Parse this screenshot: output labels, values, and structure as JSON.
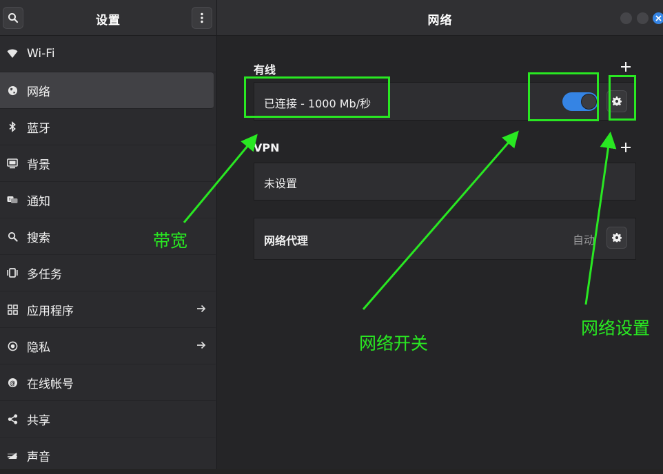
{
  "sidebar": {
    "title": "设置",
    "search_icon": "search-icon",
    "menu_icon": "kebab-menu-icon",
    "items": [
      {
        "label": "Wi-Fi",
        "icon": "wifi-icon"
      },
      {
        "label": "网络",
        "icon": "globe-icon",
        "active": true
      },
      {
        "label": "蓝牙",
        "icon": "bluetooth-icon"
      },
      {
        "label": "背景",
        "icon": "background-icon"
      },
      {
        "label": "通知",
        "icon": "notification-icon"
      },
      {
        "label": "搜索",
        "icon": "search-icon"
      },
      {
        "label": "多任务",
        "icon": "multitask-icon"
      },
      {
        "label": "应用程序",
        "icon": "apps-grid-icon",
        "arrow": true
      },
      {
        "label": "隐私",
        "icon": "privacy-icon",
        "arrow": true
      },
      {
        "label": "在线帐号",
        "icon": "online-accounts-icon"
      },
      {
        "label": "共享",
        "icon": "share-icon"
      },
      {
        "label": "声音",
        "icon": "sound-icon"
      }
    ]
  },
  "main": {
    "title": "网络",
    "wired": {
      "title": "有线",
      "status": "已连接 - 1000 Mb/秒",
      "toggle_on": true
    },
    "vpn": {
      "title": "VPN",
      "status": "未设置"
    },
    "proxy": {
      "label": "网络代理",
      "status": "自动"
    }
  },
  "annotations": {
    "bandwidth": "带宽",
    "network_switch": "网络开关",
    "network_settings": "网络设置"
  },
  "colors": {
    "accent": "#3584e4",
    "annotation": "#29e822",
    "background": "#242424"
  }
}
